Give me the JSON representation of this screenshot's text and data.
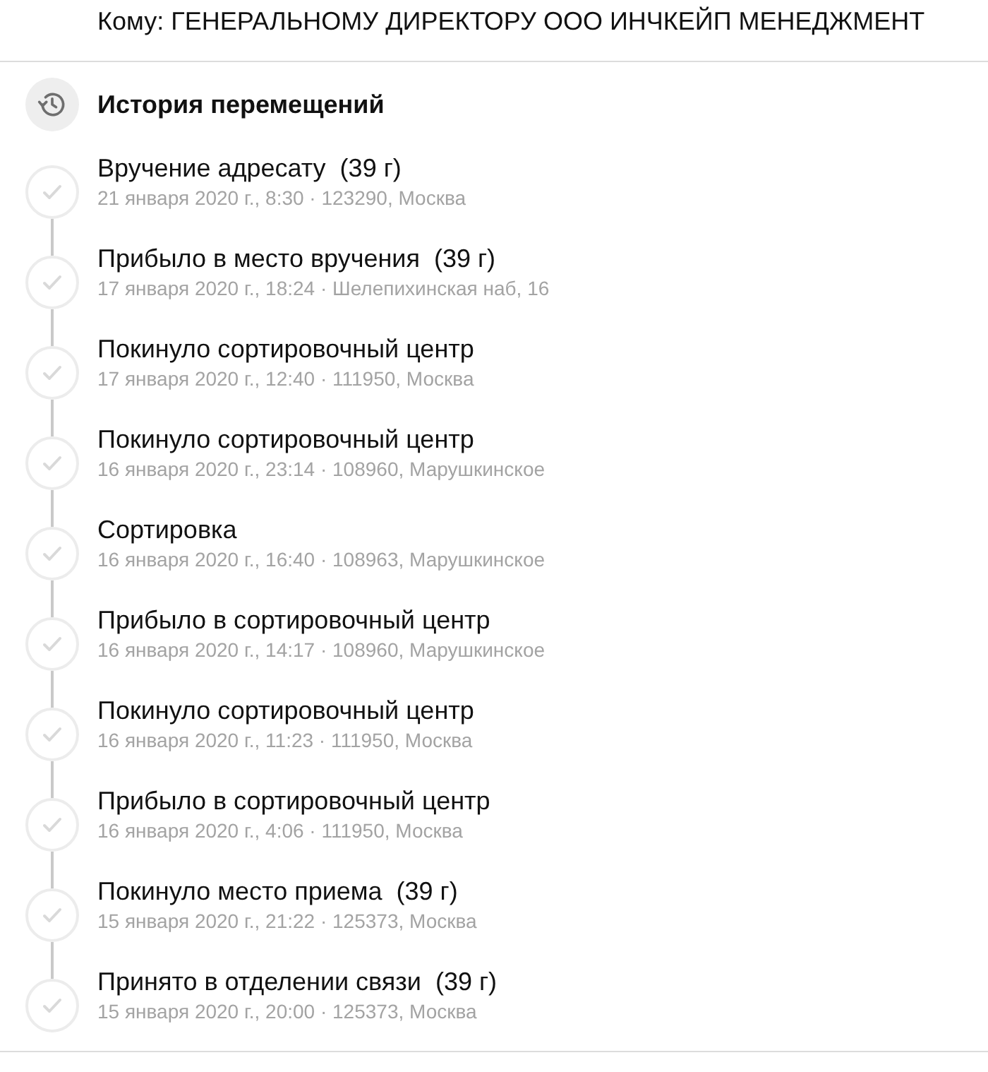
{
  "recipient": "Кому: ГЕНЕРАЛЬНОМУ ДИРЕКТОРУ ООО ИНЧКЕЙП МЕНЕДЖМЕНТ",
  "history": {
    "title": "История перемещений",
    "events": [
      {
        "title": "Вручение адресату  (39 г)",
        "details": "21 января 2020 г., 8:30 · 123290, Москва"
      },
      {
        "title": "Прибыло в место вручения  (39 г)",
        "details": "17 января 2020 г., 18:24 · Шелепихинская наб, 16"
      },
      {
        "title": "Покинуло сортировочный центр",
        "details": "17 января 2020 г., 12:40 · 111950, Москва"
      },
      {
        "title": "Покинуло сортировочный центр",
        "details": "16 января 2020 г., 23:14 · 108960, Марушкинское"
      },
      {
        "title": "Сортировка",
        "details": "16 января 2020 г., 16:40 · 108963, Марушкинское"
      },
      {
        "title": "Прибыло в сортировочный центр",
        "details": "16 января 2020 г., 14:17 · 108960, Марушкинское"
      },
      {
        "title": "Покинуло сортировочный центр",
        "details": "16 января 2020 г., 11:23 · 111950, Москва"
      },
      {
        "title": "Прибыло в сортировочный центр",
        "details": "16 января 2020 г., 4:06 · 111950, Москва"
      },
      {
        "title": "Покинуло место приема  (39 г)",
        "details": "15 января 2020 г., 21:22 · 125373, Москва"
      },
      {
        "title": "Принято в отделении связи  (39 г)",
        "details": "15 января 2020 г., 20:00 · 125373, Москва"
      }
    ]
  }
}
